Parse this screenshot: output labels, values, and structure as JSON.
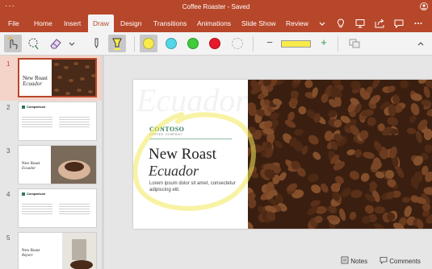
{
  "window": {
    "title": "Coffee Roaster - Saved"
  },
  "ribbon": {
    "tabs": [
      "File",
      "Home",
      "Insert",
      "Draw",
      "Design",
      "Transitions",
      "Animations",
      "Slide Show",
      "Review"
    ],
    "active_tab": "Draw",
    "accent_color": "#b7472a"
  },
  "draw_toolbar": {
    "pen_colors": [
      "#f7ec4c",
      "#52d6e8",
      "#3fcb3a",
      "#e8182b",
      "#f2f2f2"
    ],
    "selected_pen_color": "#f7ec4c",
    "stroke_minus": "−",
    "stroke_plus": "+",
    "stroke_color": "#f7ec4c"
  },
  "thumbnails": [
    {
      "number": "1",
      "title": "New Roast",
      "subtitle": "Ecuador",
      "selected": true
    },
    {
      "number": "2",
      "title": "Comparison",
      "selected": false
    },
    {
      "number": "3",
      "title": "New Roast",
      "subtitle": "Ecuador",
      "selected": false
    },
    {
      "number": "4",
      "title": "Comparison",
      "selected": false
    },
    {
      "number": "5",
      "title": "New Roast",
      "subtitle": "Report",
      "selected": false
    }
  ],
  "slide": {
    "brand": "CONTOSO",
    "brand_sub": "COFFEE COMPANY",
    "title": "New Roast",
    "subtitle": "Ecuador",
    "body": "Lorem ipsum dolor sit amet, consectetur adipiscing elit.",
    "ghost_text": "Ecuador"
  },
  "statusbar": {
    "notes_label": "Notes",
    "comments_label": "Comments"
  }
}
